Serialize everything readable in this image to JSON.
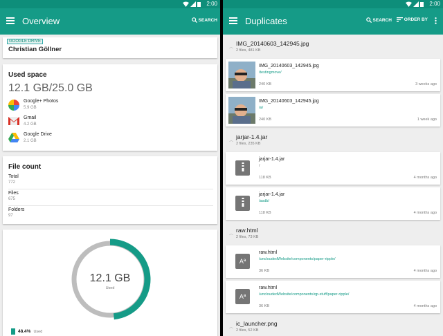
{
  "status": {
    "time": "2:00"
  },
  "left": {
    "title": "Overview",
    "search_label": "SEARCH",
    "account": {
      "tag": "GOOGLE DRIVE",
      "name": "Christian Göllner"
    },
    "used_space": {
      "heading": "Used space",
      "total": "12.1 GB/25.0 GB",
      "items": [
        {
          "name": "Google+ Photos",
          "size": "5.9 GB"
        },
        {
          "name": "Gmail",
          "size": "4.2 GB"
        },
        {
          "name": "Google Drive",
          "size": "2.1 GB"
        }
      ]
    },
    "file_count": {
      "heading": "File count",
      "rows": [
        {
          "label": "Total",
          "value": "772"
        },
        {
          "label": "Files",
          "value": "675"
        },
        {
          "label": "Folders",
          "value": "97"
        }
      ]
    },
    "donut": {
      "value": "12.1 GB",
      "caption": "Used",
      "used_fraction": 0.484,
      "legend_percent": "48.4%",
      "legend_label": "Used",
      "colors": {
        "used": "#159b87",
        "free": "#bdbdbd"
      }
    }
  },
  "right": {
    "title": "Duplicates",
    "search_label": "SEARCH",
    "order_label": "ORDER BY",
    "groups": [
      {
        "title": "IMG_20140603_142945.jpg",
        "subtitle": "2 files, 481 KB",
        "files": [
          {
            "name": "IMG_20140603_142945.jpg",
            "path": "/testingmove/",
            "size": "240 KB",
            "age": "3 weeks ago"
          },
          {
            "name": "IMG_20140603_142945.jpg",
            "path": "/a/",
            "size": "240 KB",
            "age": "1 week ago"
          }
        ]
      },
      {
        "title": "jarjar-1.4.jar",
        "subtitle": "2 files, 235 KB",
        "files": [
          {
            "name": "jarjar-1.4.jar",
            "path": "/",
            "size": "118 KB",
            "age": "4 months ago"
          },
          {
            "name": "jarjar-1.4.jar",
            "path": "/asdb/",
            "size": "118 KB",
            "age": "4 months ago"
          }
        ]
      },
      {
        "title": "raw.html",
        "subtitle": "2 files, 73 KB",
        "files": [
          {
            "name": "raw.html",
            "path": "/uncloudedWebsite/components/paper-ripple/",
            "size": "36 KB",
            "age": "4 months ago"
          },
          {
            "name": "raw.html",
            "path": "/uncloudedWebsite/components/qp-stuff/paper-ripple/",
            "size": "36 KB",
            "age": "4 months ago"
          }
        ]
      },
      {
        "title": "ic_launcher.png",
        "subtitle": "2 files, 52 KB"
      }
    ]
  }
}
